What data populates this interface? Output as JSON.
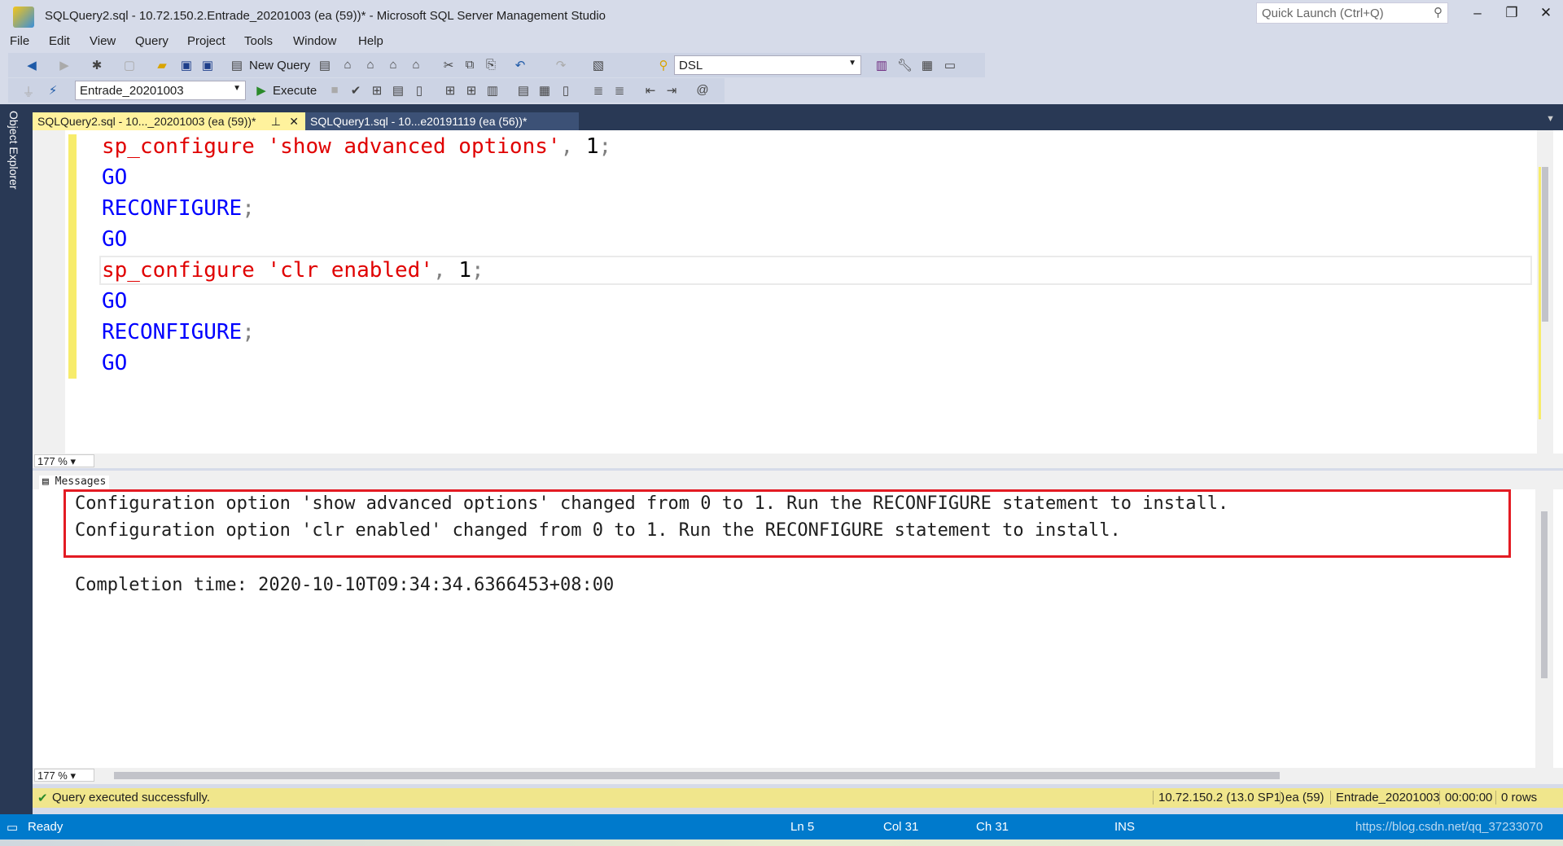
{
  "window": {
    "title": "SQLQuery2.sql - 10.72.150.2.Entrade_20201003 (ea (59))* - Microsoft SQL Server Management Studio",
    "quick_launch_placeholder": "Quick Launch (Ctrl+Q)"
  },
  "menu": [
    "File",
    "Edit",
    "View",
    "Query",
    "Project",
    "Tools",
    "Window",
    "Help"
  ],
  "toolbar": {
    "new_query": "New Query",
    "solution_combo": "DSL",
    "database_combo": "Entrade_20201003",
    "execute": "Execute"
  },
  "sidebar": {
    "object_explorer": "Object Explorer"
  },
  "tabs": [
    {
      "label": "SQLQuery2.sql - 10..._20201003 (ea (59))*",
      "active": true
    },
    {
      "label": "SQLQuery1.sql - 10...e20191119 (ea (56))*",
      "active": false
    }
  ],
  "editor": {
    "lines": [
      {
        "name": "sp_configure",
        "str": "'show advanced options'",
        "rest": ", ",
        "num": "1",
        "end": ";"
      },
      {
        "kw": "GO"
      },
      {
        "kw": "RECONFIGURE",
        "end": ";"
      },
      {
        "kw": "GO"
      },
      {
        "name": "sp_configure",
        "str": "'clr enabled'",
        "rest": ", ",
        "num": "1",
        "end": ";"
      },
      {
        "kw": "GO"
      },
      {
        "kw": "RECONFIGURE",
        "end": ";"
      },
      {
        "kw": "GO"
      }
    ],
    "zoom": "177 %"
  },
  "results": {
    "tab": "Messages",
    "messages": [
      "Configuration option 'show advanced options' changed from 0 to 1. Run the RECONFIGURE statement to install.",
      "Configuration option 'clr enabled' changed from 0 to 1. Run the RECONFIGURE statement to install."
    ],
    "completion": "Completion time: 2020-10-10T09:34:34.6366453+08:00",
    "zoom": "177 %"
  },
  "query_status": {
    "message": "Query executed successfully.",
    "server": "10.72.150.2 (13.0 SP1)",
    "user": "ea (59)",
    "database": "Entrade_20201003",
    "elapsed": "00:00:00",
    "rows": "0 rows"
  },
  "statusbar": {
    "ready": "Ready",
    "ln": "Ln 5",
    "col": "Col 31",
    "ch": "Ch 31",
    "mode": "INS",
    "watermark": "https://blog.csdn.net/qq_37233070"
  },
  "colors": {
    "keyword": "#0000ff",
    "string": "#e00000",
    "statusbar": "#007acc",
    "query_status": "#f0e68c",
    "highlight_box": "#e31b23"
  }
}
